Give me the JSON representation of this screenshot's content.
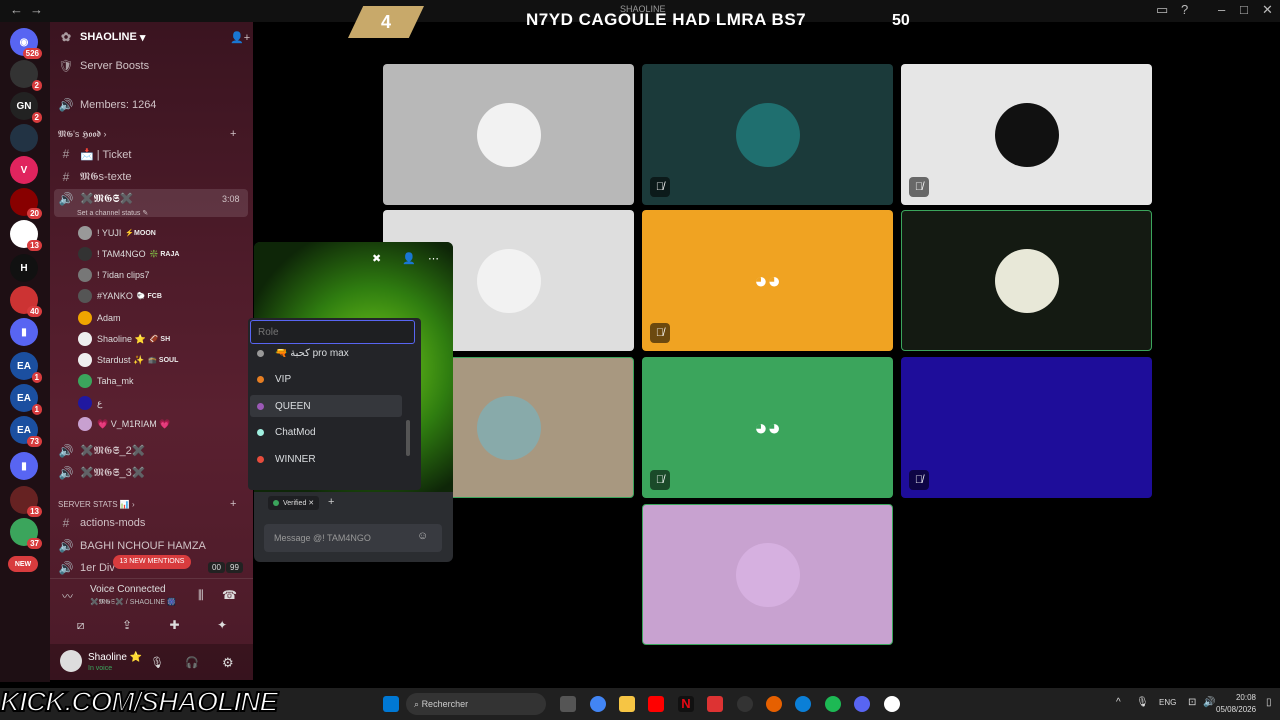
{
  "overlay": {
    "score": "4",
    "headline": "N7YD CAGOULE HAD LMRA BS7",
    "number": "50",
    "window_label": "SHAOLINE",
    "kick_text": "KICK.COM/SHAOLINE"
  },
  "rail": {
    "badges": [
      "526",
      "2",
      "2",
      "20",
      "13",
      "40",
      "1",
      "1",
      "73",
      "13",
      "37"
    ],
    "new_label": "NEW"
  },
  "server": {
    "name": "SHAOLINE",
    "boosts": "Server Boosts",
    "members": "Members: 1264",
    "category1": "𝕸𝕲's 𝕳𝖔𝖔𝖉",
    "ticket": "📩 | Ticket",
    "texte": "𝕸𝕲s-texte",
    "voice_name": "✖️𝕸𝕲𝕾✖️",
    "voice_time": "3:08",
    "voice_status": "Set a channel status ✎",
    "voice2": "✖️𝕸𝕲𝕾_2✖️",
    "voice3": "✖️𝕸𝕲𝕾_3✖️",
    "stats_cat": "SERVER STATS 📊",
    "actions": "actions-mods",
    "baghi": "BAGHI NCHOUF HAMZA",
    "div": "1er Div",
    "mentions": "13 NEW MENTIONS",
    "score_a": "00",
    "score_b": "99"
  },
  "voice_users": [
    {
      "name": "! YUJI",
      "tag": "⚡MOON",
      "color": "#999"
    },
    {
      "name": "! TAM4NGO",
      "tag": "❇️ RAJA",
      "color": "#333"
    },
    {
      "name": "! 7idan clips7",
      "tag": "",
      "color": "#777"
    },
    {
      "name": "#YANKO",
      "tag": "🐑 FCB",
      "color": "#555"
    },
    {
      "name": "Adam",
      "tag": "",
      "color": "#f0a500"
    },
    {
      "name": "Shaoline ⭐",
      "tag": "🏈 SH",
      "color": "#eee"
    },
    {
      "name": "Stardust ✨",
      "tag": "🕋 SOUL",
      "color": "#eee"
    },
    {
      "name": "Taha_mk",
      "tag": "",
      "color": "#3ba55c"
    },
    {
      "name": "ع",
      "tag": "",
      "color": "#2018a0"
    },
    {
      "name": "💗 V_M1RIAM 💗",
      "tag": "",
      "color": "#c8a0d0"
    }
  ],
  "voice_bar": {
    "status": "Voice Connected",
    "channel": "✖️𝕸𝕲𝕾✖️ / SHAOLINE 🎆"
  },
  "user": {
    "name": "Shaoline ⭐",
    "state": "In voice"
  },
  "popup": {
    "role_placeholder": "Role",
    "roles": [
      {
        "label": "🔫 كحبة pro max",
        "color": "#999"
      },
      {
        "label": "VIP",
        "color": "#e67e22"
      },
      {
        "label": "QUEEN",
        "color": "#9b59b6"
      },
      {
        "label": "ChatMod",
        "color": "#a0f0e0"
      },
      {
        "label": "WINNER",
        "color": "#e74c3c"
      }
    ],
    "verified": "Verified",
    "message_placeholder": "Message @! TAM4NGO"
  },
  "tiles": [
    {
      "bg": "#b8b8b8",
      "name": "tile-user-1"
    },
    {
      "bg": "#1b3a3a",
      "name": "tile-user-2"
    },
    {
      "bg": "#e6e6e6",
      "name": "tile-user-3"
    },
    {
      "bg": "#dedede",
      "name": "tile-user-4"
    },
    {
      "bg": "#f0a322",
      "name": "tile-user-5"
    },
    {
      "bg": "#141a12",
      "name": "tile-user-6"
    },
    {
      "bg": "#a89880",
      "name": "tile-user-7"
    },
    {
      "bg": "#3ba55c",
      "name": "tile-user-8"
    },
    {
      "bg": "#1e0d9a",
      "name": "tile-user-9"
    },
    {
      "bg": "#c8a2d0",
      "name": "tile-user-10"
    }
  ],
  "taskbar": {
    "search": "Rechercher",
    "lang": "ENG",
    "time": "20:08",
    "date": "05/08/2026"
  }
}
